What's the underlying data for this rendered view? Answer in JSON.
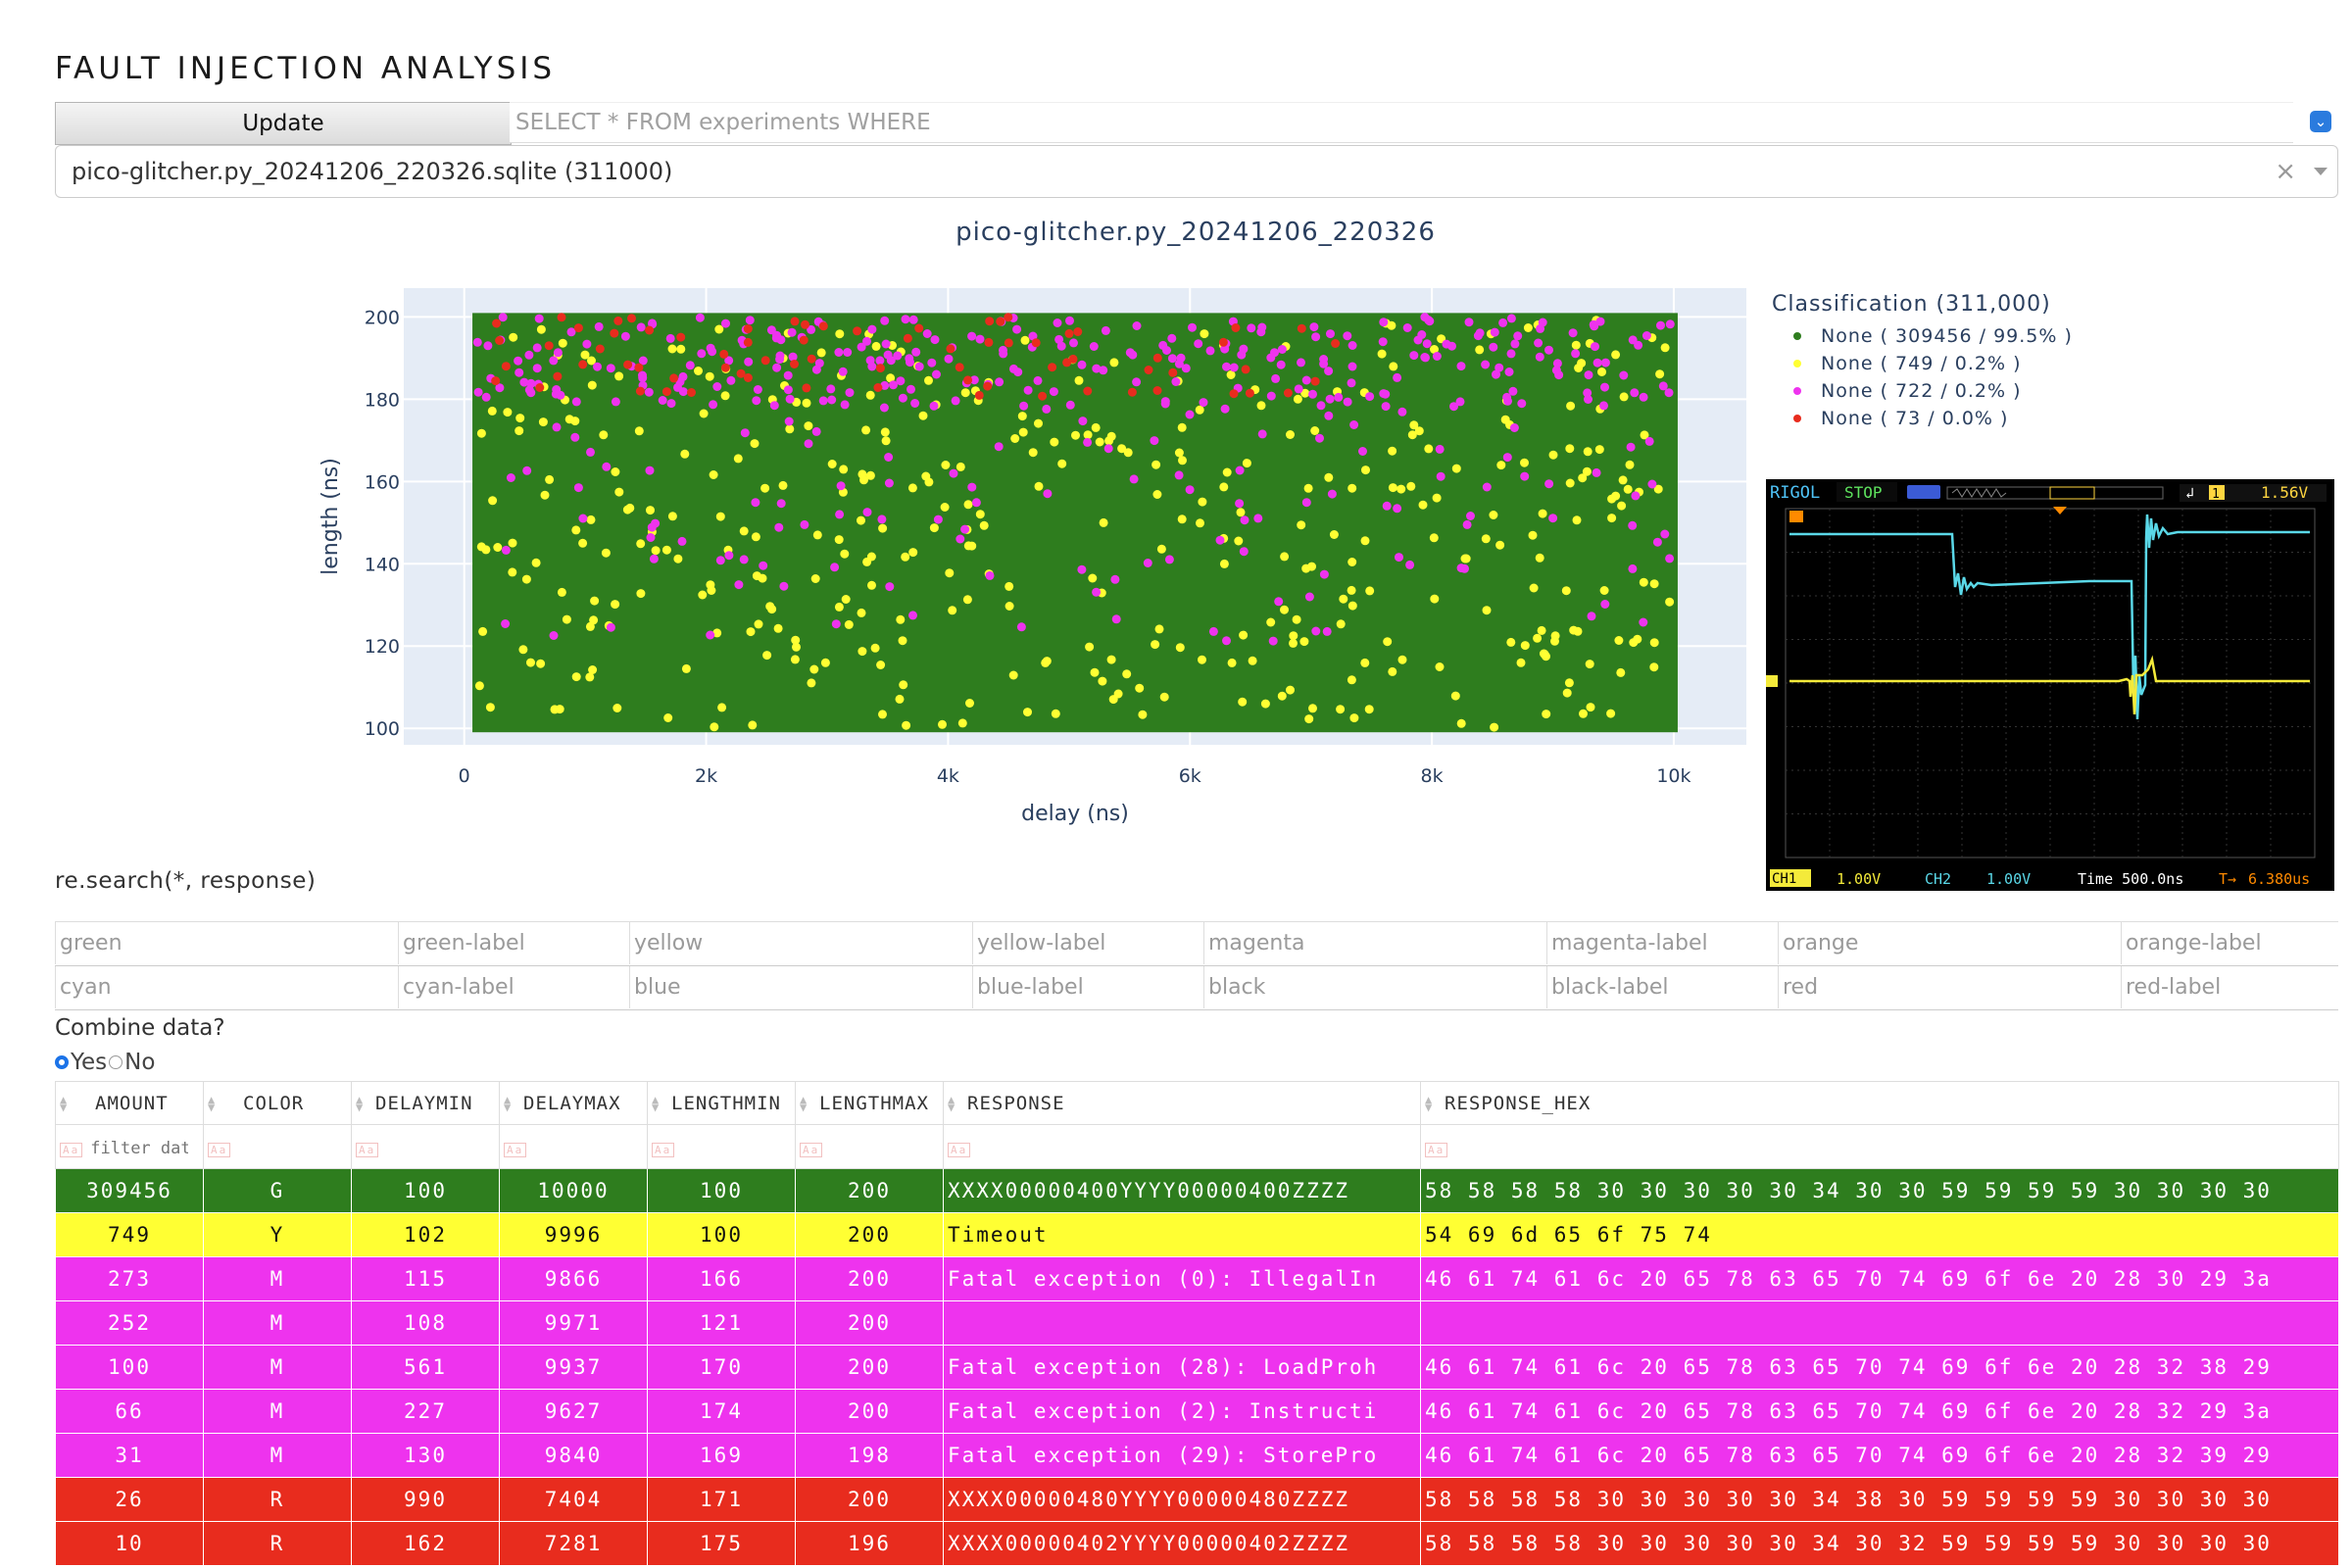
{
  "title": "FAULT INJECTION ANALYSIS",
  "toolbar": {
    "update_label": "Update",
    "query_placeholder": "SELECT * FROM experiments WHERE"
  },
  "database": {
    "selected": "pico-glitcher.py_20241206_220326.sqlite (311000)"
  },
  "chart_data": {
    "type": "scatter",
    "title": "pico-glitcher.py_20241206_220326",
    "xlabel": "delay (ns)",
    "ylabel": "length (ns)",
    "xlim": [
      -500,
      10600
    ],
    "ylim": [
      96,
      207
    ],
    "x_ticks": [
      "0",
      "2k",
      "4k",
      "6k",
      "8k",
      "10k"
    ],
    "x_tick_values": [
      0,
      2000,
      4000,
      6000,
      8000,
      10000
    ],
    "y_ticks": [
      "100",
      "120",
      "140",
      "160",
      "180",
      "200"
    ],
    "y_tick_values": [
      100,
      120,
      140,
      160,
      180,
      200
    ],
    "grid": true,
    "legend": {
      "title": "Classification (311,000)",
      "placement": "right",
      "items": [
        {
          "label": "None ( 309456 / 99.5% )",
          "color": "#2e7d1e"
        },
        {
          "label": "None ( 749 / 0.2% )",
          "color": "#ffff33"
        },
        {
          "label": "None ( 722 / 0.2% )",
          "color": "#ee33ee"
        },
        {
          "label": "None ( 73 / 0.0% )",
          "color": "#e82c1e"
        }
      ]
    },
    "series": [
      {
        "class": "G",
        "color": "#2e7d1e",
        "count": 309456,
        "x_range": [
          100,
          10000
        ],
        "y_range": [
          100,
          200
        ],
        "fill": "dense"
      },
      {
        "class": "Y",
        "color": "#ffff33",
        "count": 749,
        "x_range": [
          102,
          9996
        ],
        "y_range": [
          100,
          200
        ]
      },
      {
        "class": "M",
        "color": "#ee33ee",
        "count": 722,
        "x_range": [
          108,
          9971
        ],
        "y_range": [
          121,
          200
        ]
      },
      {
        "class": "R",
        "color": "#e82c1e",
        "count": 73,
        "x_range": [
          162,
          7404
        ],
        "y_range": [
          171,
          200
        ]
      }
    ]
  },
  "scope": {
    "brand": "RIGOL",
    "status": "STOP",
    "trigger_level": "1.56V",
    "ch1": "CH1",
    "ch1_scale": "1.00V",
    "ch2": "CH2",
    "ch2_scale": "1.00V",
    "time": "Time 500.0ns",
    "offset": "6.380us"
  },
  "regex_label": "re.search(*, response)",
  "color_fields": [
    [
      {
        "name": "green",
        "placeholder": "green"
      },
      {
        "name": "green-label",
        "placeholder": "green-label"
      },
      {
        "name": "yellow",
        "placeholder": "yellow"
      },
      {
        "name": "yellow-label",
        "placeholder": "yellow-label"
      },
      {
        "name": "magenta",
        "placeholder": "magenta"
      },
      {
        "name": "magenta-label",
        "placeholder": "magenta-label"
      },
      {
        "name": "orange",
        "placeholder": "orange"
      },
      {
        "name": "orange-label",
        "placeholder": "orange-label"
      }
    ],
    [
      {
        "name": "cyan",
        "placeholder": "cyan"
      },
      {
        "name": "cyan-label",
        "placeholder": "cyan-label"
      },
      {
        "name": "blue",
        "placeholder": "blue"
      },
      {
        "name": "blue-label",
        "placeholder": "blue-label"
      },
      {
        "name": "black",
        "placeholder": "black"
      },
      {
        "name": "black-label",
        "placeholder": "black-label"
      },
      {
        "name": "red",
        "placeholder": "red"
      },
      {
        "name": "red-label",
        "placeholder": "red-label"
      }
    ]
  ],
  "combine": {
    "label": "Combine data?",
    "options": [
      "Yes",
      "No"
    ],
    "selected": "Yes"
  },
  "table": {
    "columns": [
      "AMOUNT",
      "COLOR",
      "DELAYMIN",
      "DELAYMAX",
      "LENGTHMIN",
      "LENGTHMAX",
      "RESPONSE",
      "RESPONSE_HEX"
    ],
    "filter_placeholder": "filter data...",
    "filter_badge": "Aa",
    "colors": {
      "G": "#2e7d1e",
      "Y": "#ffff33",
      "M": "#ee33ee",
      "R": "#e82c1e"
    },
    "rows": [
      {
        "amount": "309456",
        "color": "G",
        "delaymin": "100",
        "delaymax": "10000",
        "lengthmin": "100",
        "lengthmax": "200",
        "response": "XXXX00000400YYYY00000400ZZZZ",
        "response_hex": "58 58 58 58 30 30 30 30 30 34 30 30 59 59 59 59 30 30 30 30"
      },
      {
        "amount": "749",
        "color": "Y",
        "delaymin": "102",
        "delaymax": "9996",
        "lengthmin": "100",
        "lengthmax": "200",
        "response": "Timeout",
        "response_hex": "54 69 6d 65 6f 75 74"
      },
      {
        "amount": "273",
        "color": "M",
        "delaymin": "115",
        "delaymax": "9866",
        "lengthmin": "166",
        "lengthmax": "200",
        "response": "Fatal exception (0): IllegalIn",
        "response_hex": "46 61 74 61 6c 20 65 78 63 65 70 74 69 6f 6e 20 28 30 29 3a"
      },
      {
        "amount": "252",
        "color": "M",
        "delaymin": "108",
        "delaymax": "9971",
        "lengthmin": "121",
        "lengthmax": "200",
        "response": "",
        "response_hex": ""
      },
      {
        "amount": "100",
        "color": "M",
        "delaymin": "561",
        "delaymax": "9937",
        "lengthmin": "170",
        "lengthmax": "200",
        "response": "Fatal exception (28): LoadProh",
        "response_hex": "46 61 74 61 6c 20 65 78 63 65 70 74 69 6f 6e 20 28 32 38 29"
      },
      {
        "amount": "66",
        "color": "M",
        "delaymin": "227",
        "delaymax": "9627",
        "lengthmin": "174",
        "lengthmax": "200",
        "response": "Fatal exception (2): Instructi",
        "response_hex": "46 61 74 61 6c 20 65 78 63 65 70 74 69 6f 6e 20 28 32 29 3a"
      },
      {
        "amount": "31",
        "color": "M",
        "delaymin": "130",
        "delaymax": "9840",
        "lengthmin": "169",
        "lengthmax": "198",
        "response": "Fatal exception (29): StorePro",
        "response_hex": "46 61 74 61 6c 20 65 78 63 65 70 74 69 6f 6e 20 28 32 39 29"
      },
      {
        "amount": "26",
        "color": "R",
        "delaymin": "990",
        "delaymax": "7404",
        "lengthmin": "171",
        "lengthmax": "200",
        "response": "XXXX00000480YYYY00000480ZZZZ",
        "response_hex": "58 58 58 58 30 30 30 30 30 34 38 30 59 59 59 59 30 30 30 30"
      },
      {
        "amount": "10",
        "color": "R",
        "delaymin": "162",
        "delaymax": "7281",
        "lengthmin": "175",
        "lengthmax": "196",
        "response": "XXXX00000402YYYY00000402ZZZZ",
        "response_hex": "58 58 58 58 30 30 30 30 30 34 30 32 59 59 59 59 30 30 30 30"
      }
    ]
  }
}
